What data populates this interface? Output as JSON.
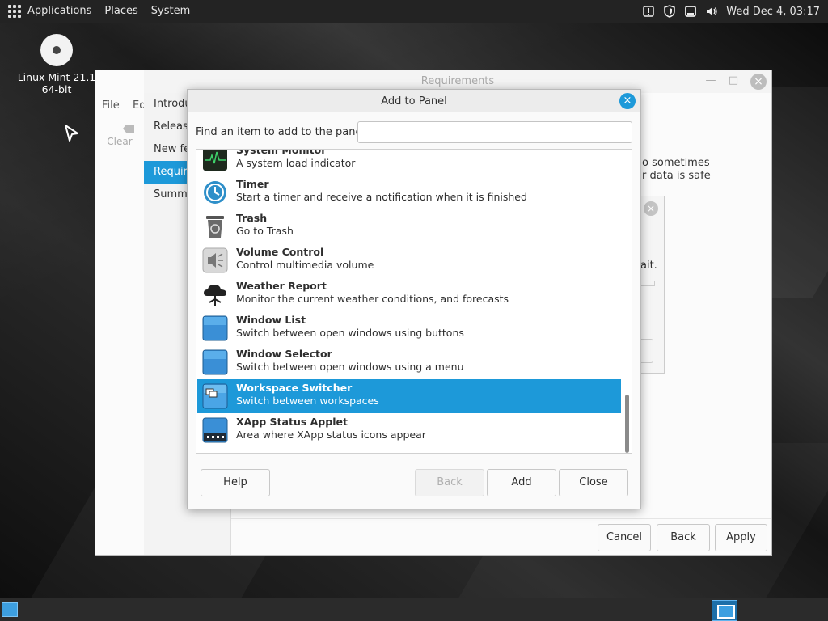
{
  "top_panel": {
    "menus": [
      "Applications",
      "Places",
      "System"
    ],
    "clock": "Wed Dec 4, 03:17",
    "tray_icons": [
      "update-manager-icon",
      "shield-icon",
      "window-icon",
      "volume-icon"
    ]
  },
  "desktop": {
    "icon_label_line1": "Linux Mint 21.1",
    "icon_label_line2": "64-bit"
  },
  "app_window": {
    "title": "Requirements",
    "menu_file": "File",
    "menu_edit": "Ed",
    "clear_label": "Clear",
    "wizard_items": [
      "Introdu",
      "Release",
      "New fe",
      "Require",
      "Summa"
    ],
    "active_index": 3,
    "body_lines": [
      "o sometimes",
      "r data is safe"
    ],
    "buttons": {
      "cancel": "Cancel",
      "back": "Back",
      "apply": "Apply"
    }
  },
  "mini_dialog": {
    "text": "ait."
  },
  "dialog": {
    "title": "Add to Panel",
    "find_label": "Find an item to add to the panel:",
    "find_value": "",
    "items": [
      {
        "name": "System Monitor",
        "desc": "A system load indicator",
        "icon": "system-monitor-icon"
      },
      {
        "name": "Timer",
        "desc": "Start a timer and receive a notification when it is finished",
        "icon": "timer-icon"
      },
      {
        "name": "Trash",
        "desc": "Go to Trash",
        "icon": "trash-icon"
      },
      {
        "name": "Volume Control",
        "desc": "Control multimedia volume",
        "icon": "volume-icon"
      },
      {
        "name": "Weather Report",
        "desc": "Monitor the current weather conditions, and forecasts",
        "icon": "weather-icon"
      },
      {
        "name": "Window List",
        "desc": "Switch between open windows using buttons",
        "icon": "window-list-icon"
      },
      {
        "name": "Window Selector",
        "desc": "Switch between open windows using a menu",
        "icon": "window-selector-icon"
      },
      {
        "name": "Workspace Switcher",
        "desc": "Switch between workspaces",
        "icon": "workspace-switcher-icon"
      },
      {
        "name": "XApp Status Applet",
        "desc": "Area where XApp status icons appear",
        "icon": "xapp-status-icon"
      }
    ],
    "selected_index": 7,
    "buttons": {
      "help": "Help",
      "back": "Back",
      "add": "Add",
      "close": "Close"
    }
  },
  "colors": {
    "accent": "#1d99d9",
    "panel": "#232323"
  }
}
